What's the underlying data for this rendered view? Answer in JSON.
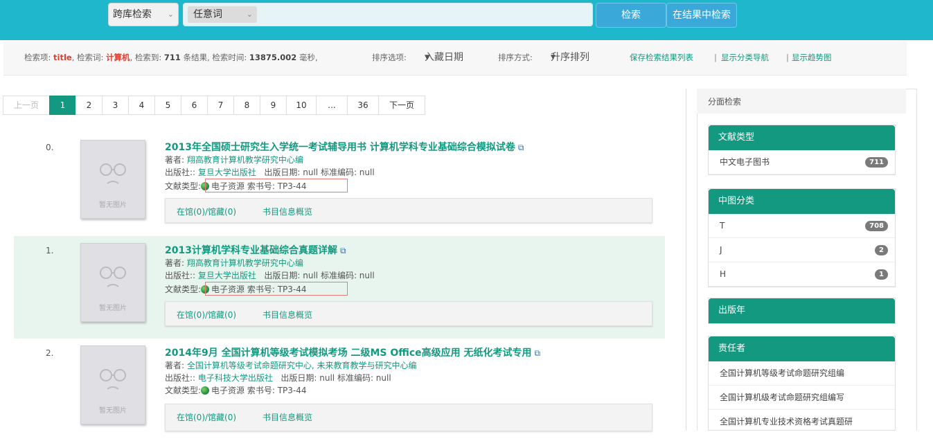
{
  "search": {
    "scope_label": "跨库检索",
    "field_label": "任意词",
    "query": "",
    "search_button": "检索",
    "refine_button": "在结果中检索"
  },
  "info": {
    "field_prefix": "检索项:",
    "field_value": "title",
    "term_prefix": ", 检索词:",
    "term_value": "计算机",
    "count_prefix": ", 检索到:",
    "count_value": "711",
    "count_suffix": "条结果, 检索时间:",
    "time_value": "13875.002",
    "time_suffix": "毫秒,",
    "sort_label": "排序选项:",
    "sort_value": "入藏日期",
    "order_label": "排序方式:",
    "order_value": "升序排列",
    "link_save": "保存检索结果列表",
    "sep1": "|",
    "link_nav": "显示分类导航",
    "sep2": "|",
    "link_trend": "显示趋势图"
  },
  "pagination": {
    "prev": "上一页",
    "pages": [
      "1",
      "2",
      "3",
      "4",
      "5",
      "6",
      "7",
      "8",
      "9",
      "10",
      "...",
      "36"
    ],
    "next": "下一页",
    "current": "1"
  },
  "results": [
    {
      "num": "0.",
      "title": "2013年全国硕士研究生入学统一考试辅导用书 计算机学科专业基础综合模拟试卷",
      "author_label": "著者:",
      "author": "翔高教育计算机教学研究中心编",
      "publisher_label": "出版社::",
      "publisher": "复旦大学出版社",
      "pubdate_text": "出版日期: null  标准编码: null",
      "type_label": "文献类型:",
      "type_value": "电子资源 索书号: TP3-44",
      "holdings": "在馆(0)/馆藏(0)",
      "overview": "书目信息概览",
      "no_image": "暂无图片"
    },
    {
      "num": "1.",
      "title": "2013计算机学科专业基础综合真题详解",
      "author_label": "著者:",
      "author": "翔高教育计算机教学研究中心编",
      "publisher_label": "出版社::",
      "publisher": "复旦大学出版社",
      "pubdate_text": "出版日期: null  标准编码: null",
      "type_label": "文献类型:",
      "type_value": "电子资源 索书号: TP3-44",
      "holdings": "在馆(0)/馆藏(0)",
      "overview": "书目信息概览",
      "no_image": "暂无图片"
    },
    {
      "num": "2.",
      "title": "2014年9月 全国计算机等级考试模拟考场 二级MS Office高级应用 无纸化考试专用",
      "author_label": "著者:",
      "author": "全国计算机等级考试命题研究中心, 未来教育教学与研究中心编",
      "publisher_label": "出版社::",
      "publisher": "电子科技大学出版社",
      "pubdate_text": "出版日期: null  标准编码: null",
      "type_label": "文献类型:",
      "type_value": "电子资源 索书号: TP3-44",
      "holdings": "在馆(0)/馆藏(0)",
      "overview": "书目信息概览",
      "no_image": "暂无图片"
    }
  ],
  "sidebar": {
    "title": "分面检索",
    "facets": [
      {
        "title": "文献类型",
        "items": [
          {
            "label": "中文电子图书",
            "count": "711"
          }
        ]
      },
      {
        "title": "中图分类",
        "items": [
          {
            "label": "T",
            "count": "708"
          },
          {
            "label": "J",
            "count": "2"
          },
          {
            "label": "H",
            "count": "1"
          }
        ]
      },
      {
        "title": "出版年",
        "items": []
      },
      {
        "title": "责任者",
        "items": [
          {
            "label": "全国计算机等级考试命题研究组编",
            "count": ""
          },
          {
            "label": "全国计算机级考试命题研究组编写",
            "count": ""
          },
          {
            "label": "全国计算机专业技术资格考试真题研",
            "count": ""
          }
        ]
      }
    ]
  },
  "colors": {
    "topbar": "#1fb7cc",
    "accent": "#12997f",
    "highlight_row": "#e8f5ee",
    "red_text": "#e23c2c"
  }
}
